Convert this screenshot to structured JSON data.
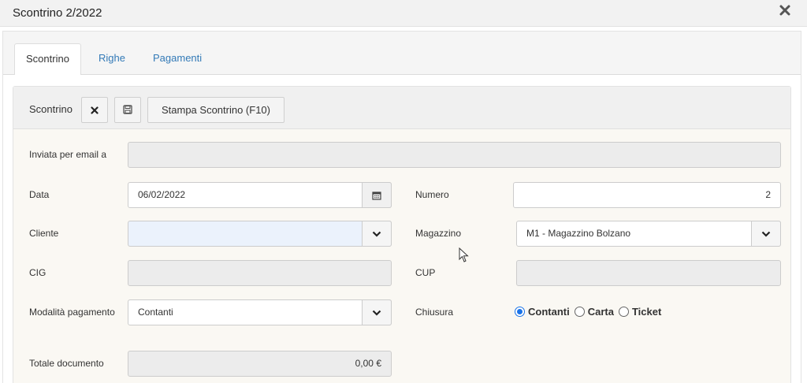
{
  "window": {
    "title": "Scontrino 2/2022",
    "close_icon": "close-icon"
  },
  "tabs": [
    {
      "label": "Scontrino",
      "active": true
    },
    {
      "label": "Righe",
      "active": false
    },
    {
      "label": "Pagamenti",
      "active": false
    }
  ],
  "toolbar": {
    "label": "Scontrino",
    "delete_icon": "x-icon",
    "save_icon": "save-icon",
    "print_label": "Stampa Scontrino (F10)"
  },
  "form": {
    "email_label": "Inviata per email a",
    "email_value": "",
    "data_label": "Data",
    "data_value": "06/02/2022",
    "numero_label": "Numero",
    "numero_value": "2",
    "cliente_label": "Cliente",
    "cliente_value": "",
    "magazzino_label": "Magazzino",
    "magazzino_value": "M1 - Magazzino Bolzano",
    "cig_label": "CIG",
    "cig_value": "",
    "cup_label": "CUP",
    "cup_value": "",
    "modalita_label": "Modalità pagamento",
    "modalita_value": "Contanti",
    "chiusura_label": "Chiusura",
    "chiusura_options": [
      "Contanti",
      "Carta",
      "Ticket"
    ],
    "chiusura_selected": "Contanti",
    "totale_label": "Totale documento",
    "totale_value": "0,00 €"
  },
  "colors": {
    "link": "#337ab7",
    "radio_accent": "#1a73e8",
    "field_bg": "#ececec",
    "cliente_bg": "#ebf2fc"
  }
}
